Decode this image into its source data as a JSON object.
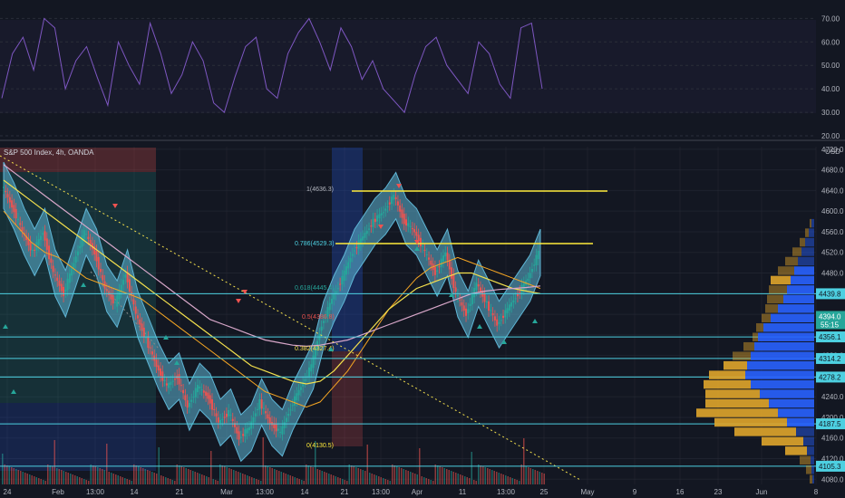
{
  "header": {
    "symbol_title": "S&P 500 Index, 4h, OANDA",
    "currency": "USD"
  },
  "colors": {
    "bg": "#131722",
    "grid": "#2a2e39",
    "rsi": "#7e57c2",
    "band": "#5fb6d6",
    "ema_fast": "#f6a623",
    "ema_slow": "#f4e04d",
    "sma": "#d8a7c9",
    "up": "#26a69a",
    "down": "#ef5350",
    "level": "#4dd0e1",
    "fib": "#ffeb3b",
    "vp_buy": "#2962ff",
    "vp_sell": "#e0a52b"
  },
  "chart_data": [
    {
      "type": "line",
      "title": "",
      "series": [
        {
          "values": [
            36,
            55,
            62,
            48,
            70,
            66,
            40,
            52,
            58,
            45,
            33,
            60,
            50,
            42,
            68,
            55,
            38,
            46,
            60,
            52,
            34,
            30,
            45,
            58,
            62,
            40,
            36,
            55,
            64,
            70,
            60,
            48,
            66,
            58,
            44,
            52,
            40,
            35,
            30,
            46,
            58,
            62,
            50,
            44,
            38,
            60,
            55,
            42,
            36,
            66,
            68,
            40
          ]
        }
      ],
      "ylim": [
        20,
        74
      ],
      "y_ticks": [
        "70.00",
        "60.00",
        "50.00",
        "40.00",
        "30.00",
        "20.00"
      ]
    },
    {
      "type": "line",
      "title": "S&P 500 Index, 4h, OANDA",
      "x_ticks": [
        "24",
        "Feb",
        "13:00",
        "14",
        "21",
        "Mar",
        "13:00",
        "14",
        "21",
        "13:00",
        "Apr",
        "11",
        "13:00",
        "25",
        "May",
        "9",
        "16",
        "23",
        "Jun",
        "8"
      ],
      "y_ticks": [
        "4720.0",
        "4680.0",
        "4640.0",
        "4600.0",
        "4560.0",
        "4520.0",
        "4480.0",
        "4440.0",
        "4400.0",
        "4360.0",
        "4320.0",
        "4280.0",
        "4240.0",
        "4200.0",
        "4160.0",
        "4120.0",
        "4080.0"
      ],
      "ylim": [
        4070,
        4725
      ],
      "series": [
        {
          "values": [
            4650,
            4610,
            4560,
            4520,
            4560,
            4480,
            4440,
            4500,
            4560,
            4520,
            4450,
            4420,
            4480,
            4400,
            4350,
            4300,
            4260,
            4280,
            4220,
            4260,
            4240,
            4190,
            4210,
            4160,
            4180,
            4230,
            4190,
            4170,
            4220,
            4260,
            4300,
            4380,
            4430,
            4470,
            4520,
            4550,
            4580,
            4600,
            4630,
            4580,
            4560,
            4520,
            4480,
            4520,
            4440,
            4400,
            4460,
            4420,
            4380,
            4410,
            4440,
            4470,
            4520
          ]
        },
        {
          "values": [
            4600,
            4570,
            4540,
            4520,
            4510,
            4490,
            4470,
            4460,
            4450,
            4440,
            4430,
            4410,
            4390,
            4370,
            4350,
            4330,
            4310,
            4290,
            4270,
            4250,
            4240,
            4230,
            4220,
            4230,
            4260,
            4290,
            4330,
            4370,
            4410,
            4440,
            4470,
            4490,
            4500,
            4510,
            4500,
            4490,
            4480,
            4470,
            4460,
            4450
          ]
        },
        {
          "values": [
            4660,
            4640,
            4620,
            4600,
            4580,
            4560,
            4540,
            4520,
            4500,
            4480,
            4460,
            4440,
            4420,
            4400,
            4380,
            4360,
            4340,
            4320,
            4300,
            4290,
            4280,
            4270,
            4265,
            4270,
            4290,
            4320,
            4350,
            4380,
            4410,
            4430,
            4450,
            4460,
            4470,
            4480,
            4480,
            4470,
            4460,
            4450,
            4445,
            4440
          ]
        },
        {
          "values": [
            4690,
            4670,
            4650,
            4630,
            4610,
            4590,
            4570,
            4550,
            4530,
            4510,
            4490,
            4470,
            4450,
            4430,
            4410,
            4390,
            4380,
            4370,
            4360,
            4350,
            4345,
            4340,
            4338,
            4340,
            4345,
            4350,
            4360,
            4370,
            4380,
            4390,
            4400,
            4410,
            4420,
            4430,
            4440,
            4445,
            4448,
            4450,
            4452,
            4455
          ]
        }
      ],
      "bands": {
        "upper_offset": 45,
        "lower_offset": 45
      },
      "levels": [
        {
          "value": "4439.8"
        },
        {
          "value": "4356.1"
        },
        {
          "value": "4314.2"
        },
        {
          "value": "4278.2"
        },
        {
          "value": "4187.5"
        },
        {
          "value": "4105.3"
        }
      ],
      "price_tags": [
        "4394.0",
        "55:15"
      ],
      "fib_labels": [
        "1(4636.3)",
        "0.786(4529.3)",
        "0.618(4445.4)",
        "0.5(4386.8)",
        "0.382(4327.4)",
        "0(4130.5)"
      ]
    },
    {
      "type": "bar",
      "title": "",
      "series": [
        {
          "name": "buy",
          "values": [
            0,
            0,
            0,
            0,
            3,
            6,
            10,
            14,
            18,
            22,
            26,
            30,
            34,
            40,
            48,
            56,
            62,
            66,
            70,
            74,
            76,
            70,
            60,
            50,
            40,
            30,
            20,
            12,
            8,
            4,
            3,
            2
          ]
        },
        {
          "name": "sell",
          "values": [
            0,
            0,
            0,
            0,
            2,
            4,
            6,
            10,
            14,
            18,
            22,
            20,
            18,
            14,
            10,
            8,
            6,
            12,
            20,
            26,
            40,
            52,
            60,
            70,
            90,
            80,
            68,
            46,
            24,
            12,
            6,
            3
          ]
        }
      ]
    }
  ]
}
